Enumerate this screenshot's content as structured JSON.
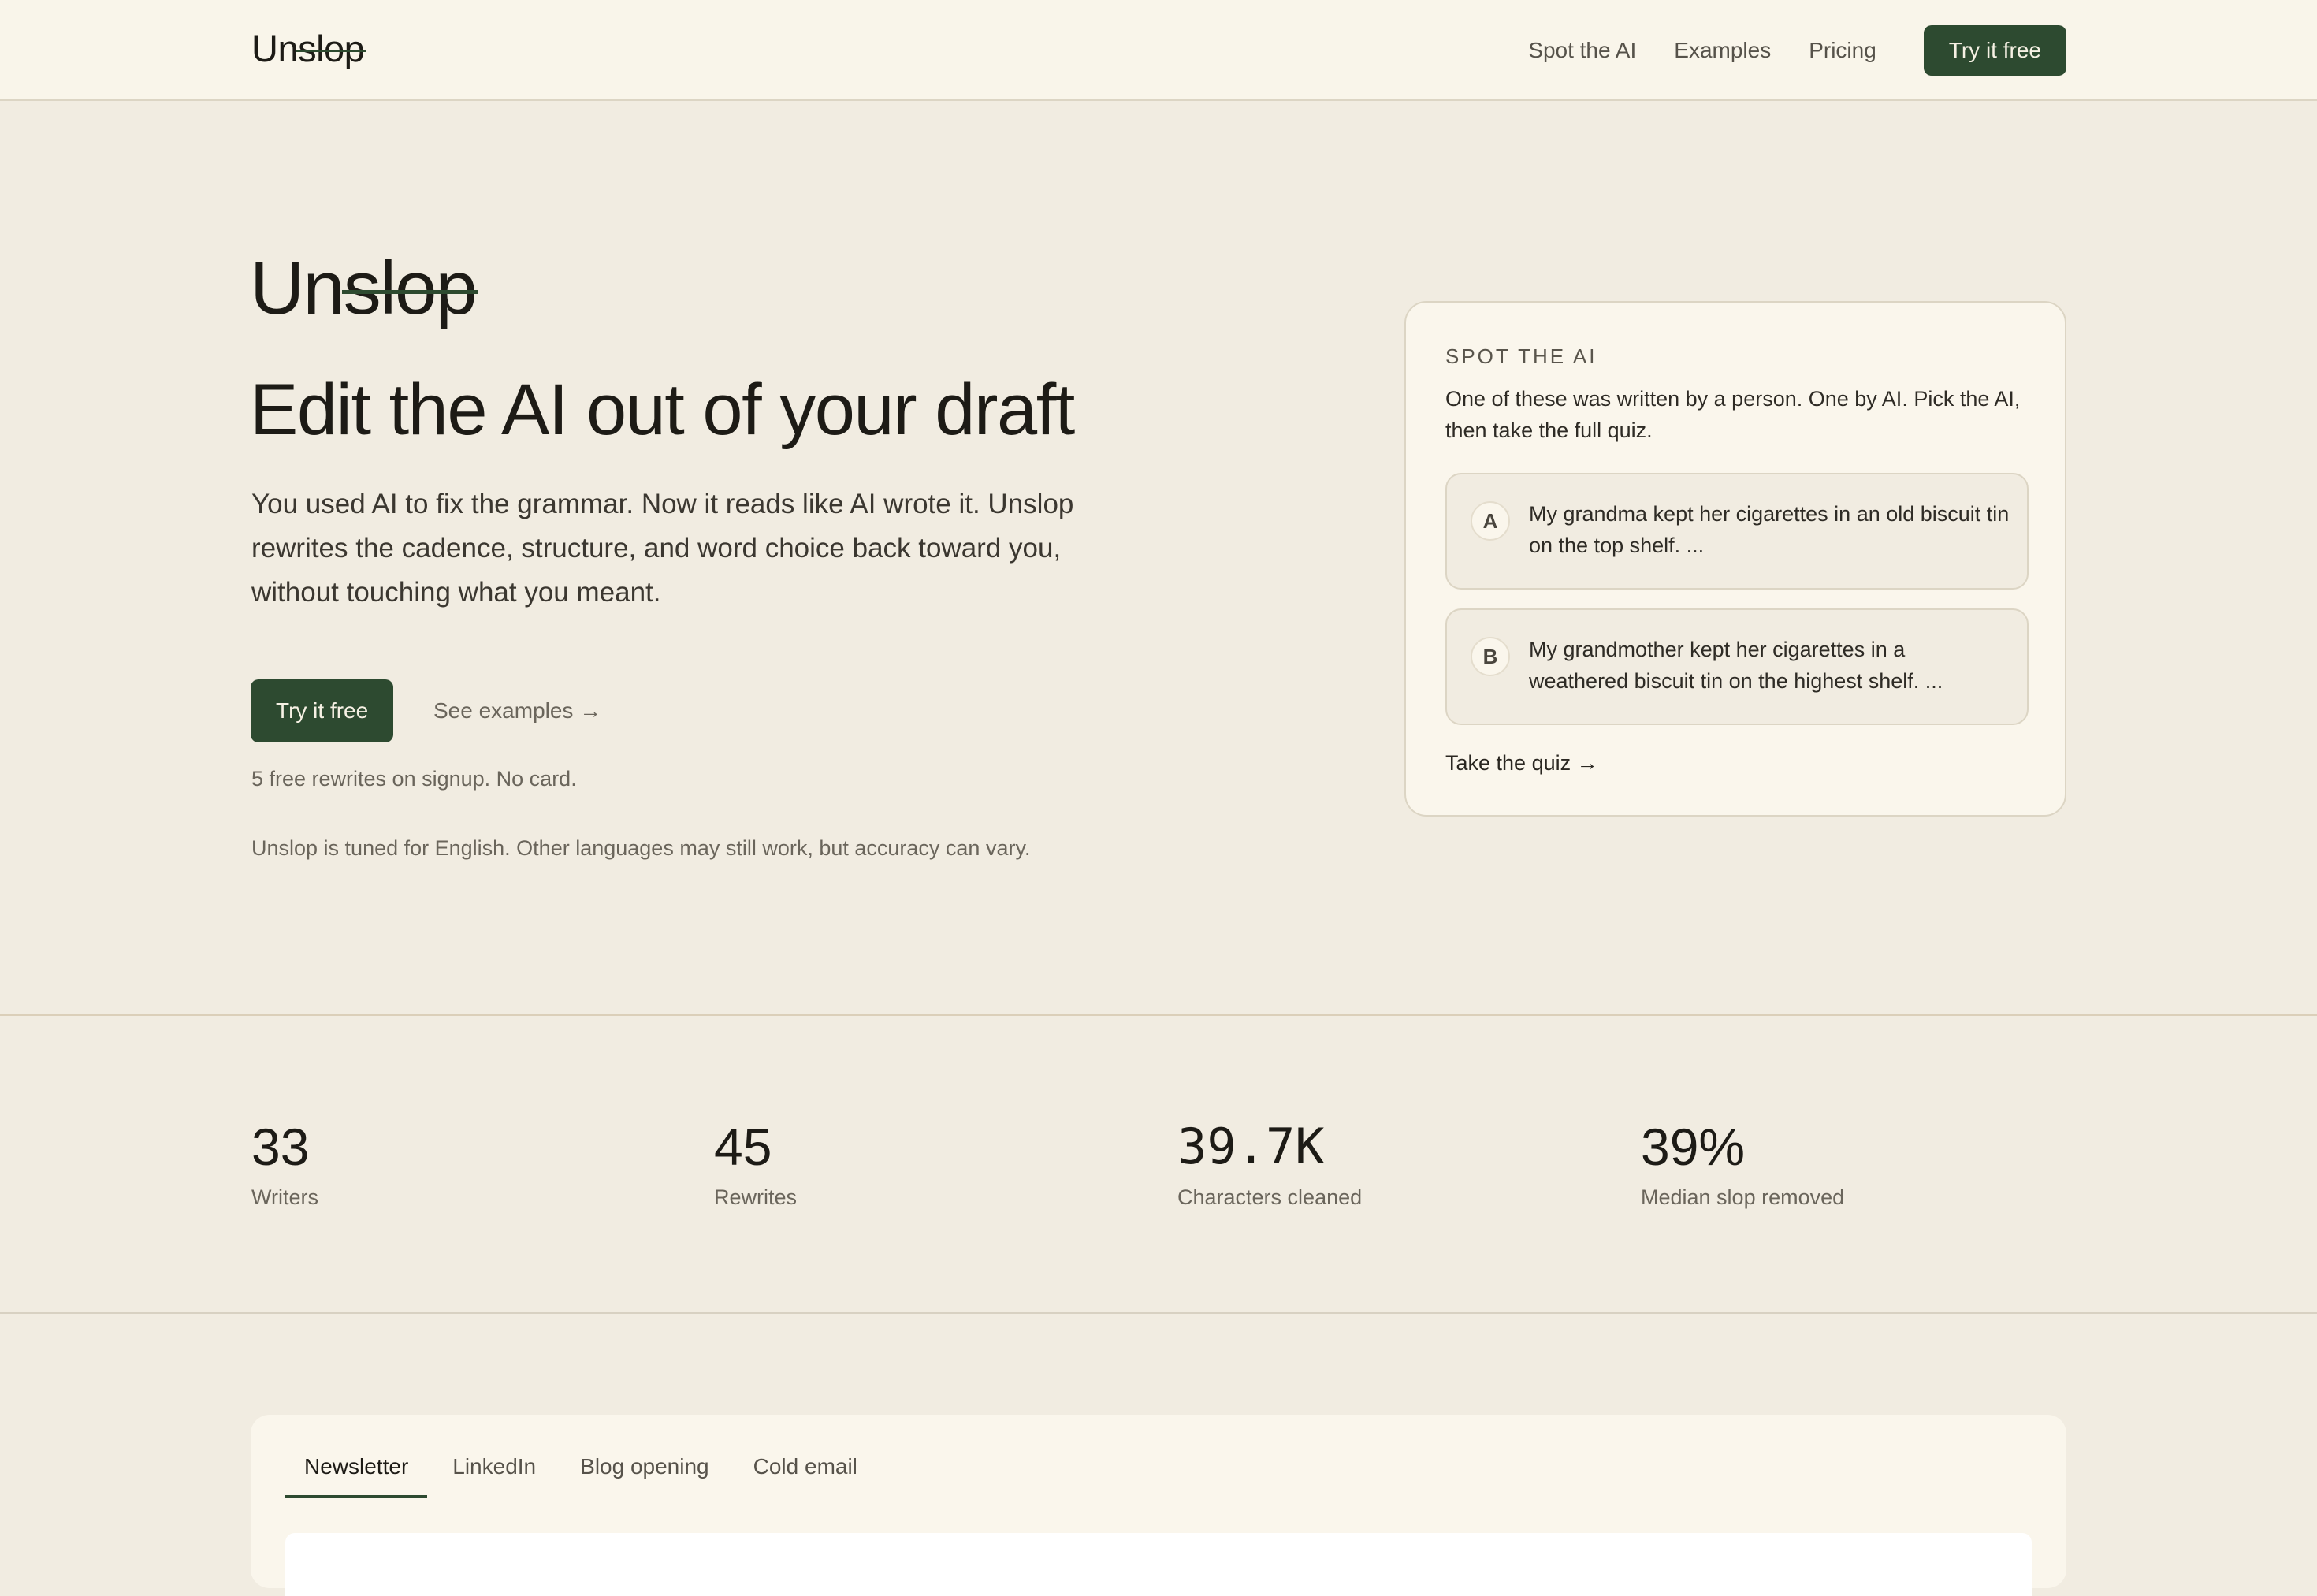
{
  "header": {
    "logo_prefix": "Un",
    "logo_struck": "slop",
    "nav": [
      "Spot the AI",
      "Examples",
      "Pricing"
    ],
    "cta": "Try it free"
  },
  "hero": {
    "logo_prefix": "Un",
    "logo_struck": "slop",
    "title": "Edit the AI out of your draft",
    "description": "You used AI to fix the grammar. Now it reads like AI wrote it. Unslop rewrites the cadence, structure, and word choice back toward you, without touching what you meant.",
    "cta_primary": "Try it free",
    "cta_secondary": "See examples →",
    "free_note": "5 free rewrites on signup. No card.",
    "language_note": "Unslop is tuned for English. Other languages may still work, but accuracy can vary."
  },
  "quiz": {
    "kicker": "SPOT THE AI",
    "intro": "One of these was written by a person. One by AI. Pick the AI, then take the full quiz.",
    "options": [
      {
        "letter": "A",
        "text": "My grandma kept her cigarettes in an old biscuit tin on the top shelf. ..."
      },
      {
        "letter": "B",
        "text": "My grandmother kept her cigarettes in a weathered biscuit tin on the highest shelf. ..."
      }
    ],
    "link": "Take the quiz →"
  },
  "stats": [
    {
      "value": "33",
      "label": "Writers"
    },
    {
      "value": "45",
      "label": "Rewrites"
    },
    {
      "value": "39.7K",
      "label": "Characters cleaned"
    },
    {
      "value": "39%",
      "label": "Median slop removed"
    }
  ],
  "tabs": {
    "items": [
      "Newsletter",
      "LinkedIn",
      "Blog opening",
      "Cold email"
    ],
    "active": "Newsletter"
  }
}
